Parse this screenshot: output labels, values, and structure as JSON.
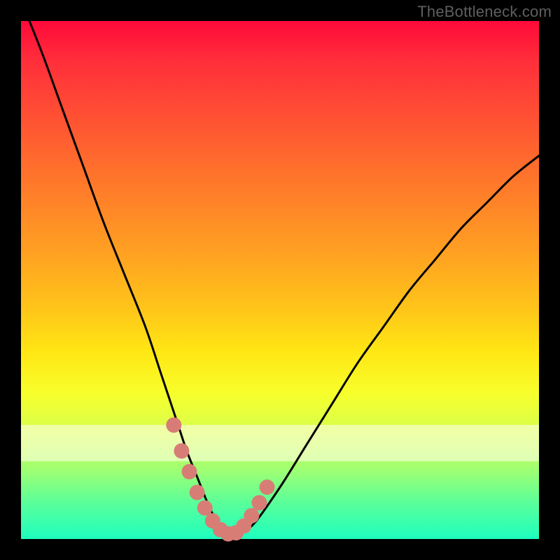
{
  "watermark": "TheBottleneck.com",
  "colors": {
    "frame": "#000000",
    "gradient_top": "#ff0a3a",
    "gradient_bottom": "#1effbf",
    "curve": "#000000",
    "marker": "#d77d76",
    "watermark": "#5f5f5f"
  },
  "chart_data": {
    "type": "line",
    "title": "",
    "xlabel": "",
    "ylabel": "",
    "xlim": [
      0,
      100
    ],
    "ylim": [
      0,
      100
    ],
    "curve": {
      "name": "bottleneck-curve",
      "x": [
        0,
        4,
        8,
        12,
        16,
        20,
        24,
        27,
        30,
        32,
        34,
        36,
        38,
        40,
        42,
        45,
        50,
        55,
        60,
        65,
        70,
        75,
        80,
        85,
        90,
        95,
        100
      ],
      "y": [
        104,
        94,
        83,
        72,
        61,
        51,
        41,
        32,
        23,
        17,
        12,
        7,
        3,
        1,
        1,
        3,
        10,
        18,
        26,
        34,
        41,
        48,
        54,
        60,
        65,
        70,
        74
      ]
    },
    "markers": {
      "name": "highlight-band",
      "x": [
        29.5,
        31,
        32.5,
        34,
        35.5,
        37,
        38.5,
        40,
        41.5,
        43,
        44.5,
        46,
        47.5
      ],
      "y": [
        22,
        17,
        13,
        9,
        6,
        3.5,
        1.8,
        1,
        1.2,
        2.5,
        4.5,
        7,
        10
      ]
    },
    "ivory_band": {
      "y_from": 15,
      "y_to": 22
    }
  }
}
